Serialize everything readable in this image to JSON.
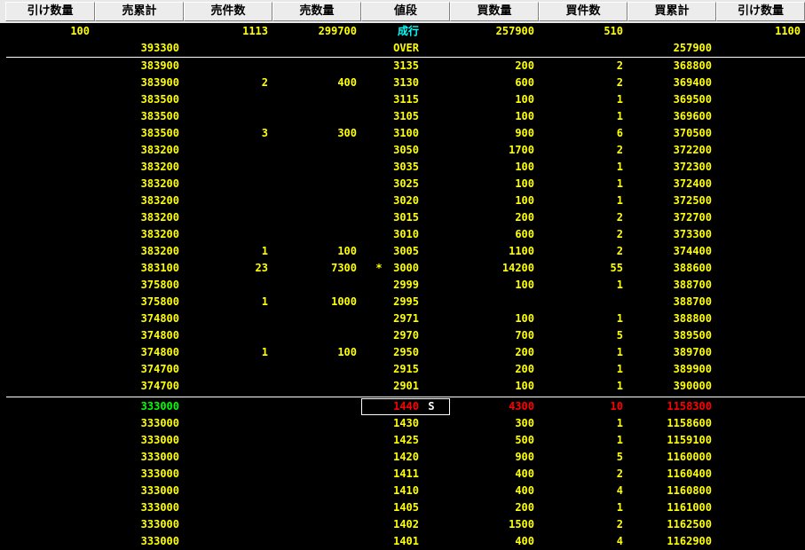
{
  "header": [
    "引け数量",
    "売累計",
    "売件数",
    "売数量",
    "値段",
    "買数量",
    "買件数",
    "買累計",
    "引け数量"
  ],
  "top_rows": [
    {
      "ask_close": "100",
      "ask_cum": "",
      "ask_cnt": "1113",
      "ask_qty": "299700",
      "price": "成行",
      "mark": "",
      "bid_qty": "257900",
      "bid_cnt": "510",
      "bid_cum": "",
      "bid_close": "1100"
    },
    {
      "ask_close": "",
      "ask_cum": "393300",
      "ask_cnt": "",
      "ask_qty": "",
      "price": "OVER",
      "mark": "",
      "bid_qty": "",
      "bid_cnt": "",
      "bid_cum": "257900",
      "bid_close": ""
    }
  ],
  "book_rows": [
    {
      "ask_cum": "383900",
      "ask_cnt": "",
      "ask_qty": "",
      "mark": "",
      "price": "3135",
      "bid_qty": "200",
      "bid_cnt": "2",
      "bid_cum": "368800"
    },
    {
      "ask_cum": "383900",
      "ask_cnt": "2",
      "ask_qty": "400",
      "mark": "",
      "price": "3130",
      "bid_qty": "600",
      "bid_cnt": "2",
      "bid_cum": "369400"
    },
    {
      "ask_cum": "383500",
      "ask_cnt": "",
      "ask_qty": "",
      "mark": "",
      "price": "3115",
      "bid_qty": "100",
      "bid_cnt": "1",
      "bid_cum": "369500"
    },
    {
      "ask_cum": "383500",
      "ask_cnt": "",
      "ask_qty": "",
      "mark": "",
      "price": "3105",
      "bid_qty": "100",
      "bid_cnt": "1",
      "bid_cum": "369600"
    },
    {
      "ask_cum": "383500",
      "ask_cnt": "3",
      "ask_qty": "300",
      "mark": "",
      "price": "3100",
      "bid_qty": "900",
      "bid_cnt": "6",
      "bid_cum": "370500"
    },
    {
      "ask_cum": "383200",
      "ask_cnt": "",
      "ask_qty": "",
      "mark": "",
      "price": "3050",
      "bid_qty": "1700",
      "bid_cnt": "2",
      "bid_cum": "372200"
    },
    {
      "ask_cum": "383200",
      "ask_cnt": "",
      "ask_qty": "",
      "mark": "",
      "price": "3035",
      "bid_qty": "100",
      "bid_cnt": "1",
      "bid_cum": "372300"
    },
    {
      "ask_cum": "383200",
      "ask_cnt": "",
      "ask_qty": "",
      "mark": "",
      "price": "3025",
      "bid_qty": "100",
      "bid_cnt": "1",
      "bid_cum": "372400"
    },
    {
      "ask_cum": "383200",
      "ask_cnt": "",
      "ask_qty": "",
      "mark": "",
      "price": "3020",
      "bid_qty": "100",
      "bid_cnt": "1",
      "bid_cum": "372500"
    },
    {
      "ask_cum": "383200",
      "ask_cnt": "",
      "ask_qty": "",
      "mark": "",
      "price": "3015",
      "bid_qty": "200",
      "bid_cnt": "2",
      "bid_cum": "372700"
    },
    {
      "ask_cum": "383200",
      "ask_cnt": "",
      "ask_qty": "",
      "mark": "",
      "price": "3010",
      "bid_qty": "600",
      "bid_cnt": "2",
      "bid_cum": "373300"
    },
    {
      "ask_cum": "383200",
      "ask_cnt": "1",
      "ask_qty": "100",
      "mark": "",
      "price": "3005",
      "bid_qty": "1100",
      "bid_cnt": "2",
      "bid_cum": "374400"
    },
    {
      "ask_cum": "383100",
      "ask_cnt": "23",
      "ask_qty": "7300",
      "mark": "*",
      "price": "3000",
      "bid_qty": "14200",
      "bid_cnt": "55",
      "bid_cum": "388600"
    },
    {
      "ask_cum": "375800",
      "ask_cnt": "",
      "ask_qty": "",
      "mark": "",
      "price": "2999",
      "bid_qty": "100",
      "bid_cnt": "1",
      "bid_cum": "388700"
    },
    {
      "ask_cum": "375800",
      "ask_cnt": "1",
      "ask_qty": "1000",
      "mark": "",
      "price": "2995",
      "bid_qty": "",
      "bid_cnt": "",
      "bid_cum": "388700"
    },
    {
      "ask_cum": "374800",
      "ask_cnt": "",
      "ask_qty": "",
      "mark": "",
      "price": "2971",
      "bid_qty": "100",
      "bid_cnt": "1",
      "bid_cum": "388800"
    },
    {
      "ask_cum": "374800",
      "ask_cnt": "",
      "ask_qty": "",
      "mark": "",
      "price": "2970",
      "bid_qty": "700",
      "bid_cnt": "5",
      "bid_cum": "389500"
    },
    {
      "ask_cum": "374800",
      "ask_cnt": "1",
      "ask_qty": "100",
      "mark": "",
      "price": "2950",
      "bid_qty": "200",
      "bid_cnt": "1",
      "bid_cum": "389700"
    },
    {
      "ask_cum": "374700",
      "ask_cnt": "",
      "ask_qty": "",
      "mark": "",
      "price": "2915",
      "bid_qty": "200",
      "bid_cnt": "1",
      "bid_cum": "389900"
    },
    {
      "ask_cum": "374700",
      "ask_cnt": "",
      "ask_qty": "",
      "mark": "",
      "price": "2901",
      "bid_qty": "100",
      "bid_cnt": "1",
      "bid_cum": "390000"
    }
  ],
  "special_row": {
    "ask_cum": "333000",
    "price": "1440",
    "flag": "S",
    "bid_qty": "4300",
    "bid_cnt": "10",
    "bid_cum": "1158300"
  },
  "lower_rows": [
    {
      "ask_cum": "333000",
      "price": "1430",
      "bid_qty": "300",
      "bid_cnt": "1",
      "bid_cum": "1158600"
    },
    {
      "ask_cum": "333000",
      "price": "1425",
      "bid_qty": "500",
      "bid_cnt": "1",
      "bid_cum": "1159100"
    },
    {
      "ask_cum": "333000",
      "price": "1420",
      "bid_qty": "900",
      "bid_cnt": "5",
      "bid_cum": "1160000"
    },
    {
      "ask_cum": "333000",
      "price": "1411",
      "bid_qty": "400",
      "bid_cnt": "2",
      "bid_cum": "1160400"
    },
    {
      "ask_cum": "333000",
      "price": "1410",
      "bid_qty": "400",
      "bid_cnt": "4",
      "bid_cum": "1160800"
    },
    {
      "ask_cum": "333000",
      "price": "1405",
      "bid_qty": "200",
      "bid_cnt": "1",
      "bid_cum": "1161000"
    },
    {
      "ask_cum": "333000",
      "price": "1402",
      "bid_qty": "1500",
      "bid_cnt": "2",
      "bid_cum": "1162500"
    },
    {
      "ask_cum": "333000",
      "price": "1401",
      "bid_qty": "400",
      "bid_cnt": "4",
      "bid_cum": "1162900"
    }
  ],
  "colors": {
    "text": "#ffff00",
    "market_price": "#00ffff",
    "special_ask": "#00ff00",
    "special_bid": "#ff0000",
    "background": "#000000"
  }
}
